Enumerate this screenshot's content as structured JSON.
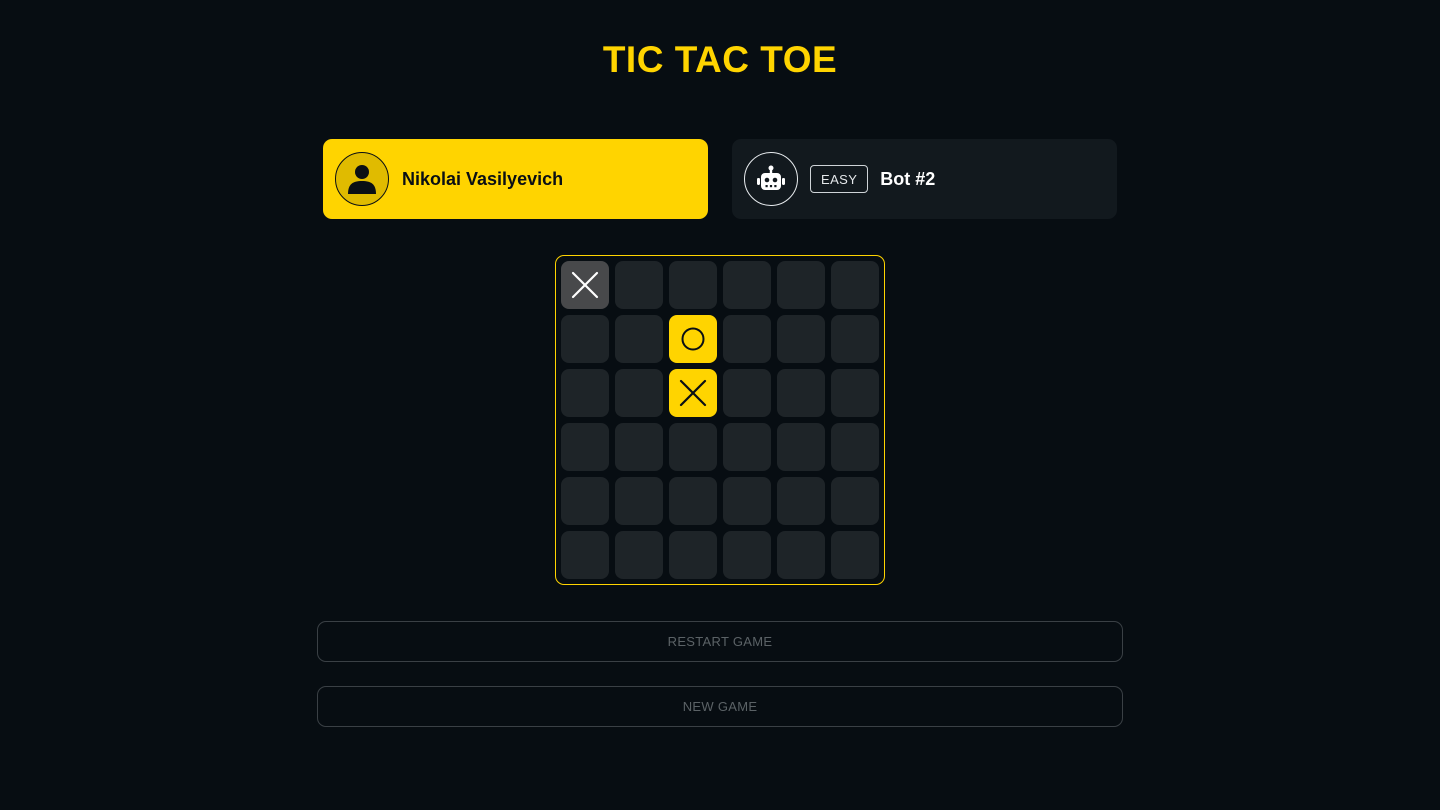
{
  "header": {
    "title": "TIC TAC TOE"
  },
  "players": {
    "human": {
      "name": "Nikolai Vasilyevich",
      "icon": "user-icon"
    },
    "bot": {
      "name": "Bot #2",
      "difficulty": "EASY",
      "icon": "robot-icon"
    }
  },
  "board": {
    "size": 6,
    "cells": [
      [
        "X",
        "",
        "",
        "",
        "",
        ""
      ],
      [
        "",
        "",
        "O",
        "",
        "",
        ""
      ],
      [
        "",
        "",
        "X",
        "",
        "",
        ""
      ],
      [
        "",
        "",
        "",
        "",
        "",
        ""
      ],
      [
        "",
        "",
        "",
        "",
        "",
        ""
      ],
      [
        "",
        "",
        "",
        "",
        "",
        ""
      ]
    ],
    "last_move": [
      0,
      0
    ],
    "highlighted": [
      [
        1,
        2
      ],
      [
        2,
        2
      ]
    ]
  },
  "actions": {
    "restart_label": "RESTART GAME",
    "new_game_label": "NEW GAME"
  },
  "colors": {
    "background": "#070d12",
    "accent": "#ffd400",
    "cell": "#1e2428",
    "last_move_cell": "#48494b",
    "bot_card": "#12191e"
  }
}
